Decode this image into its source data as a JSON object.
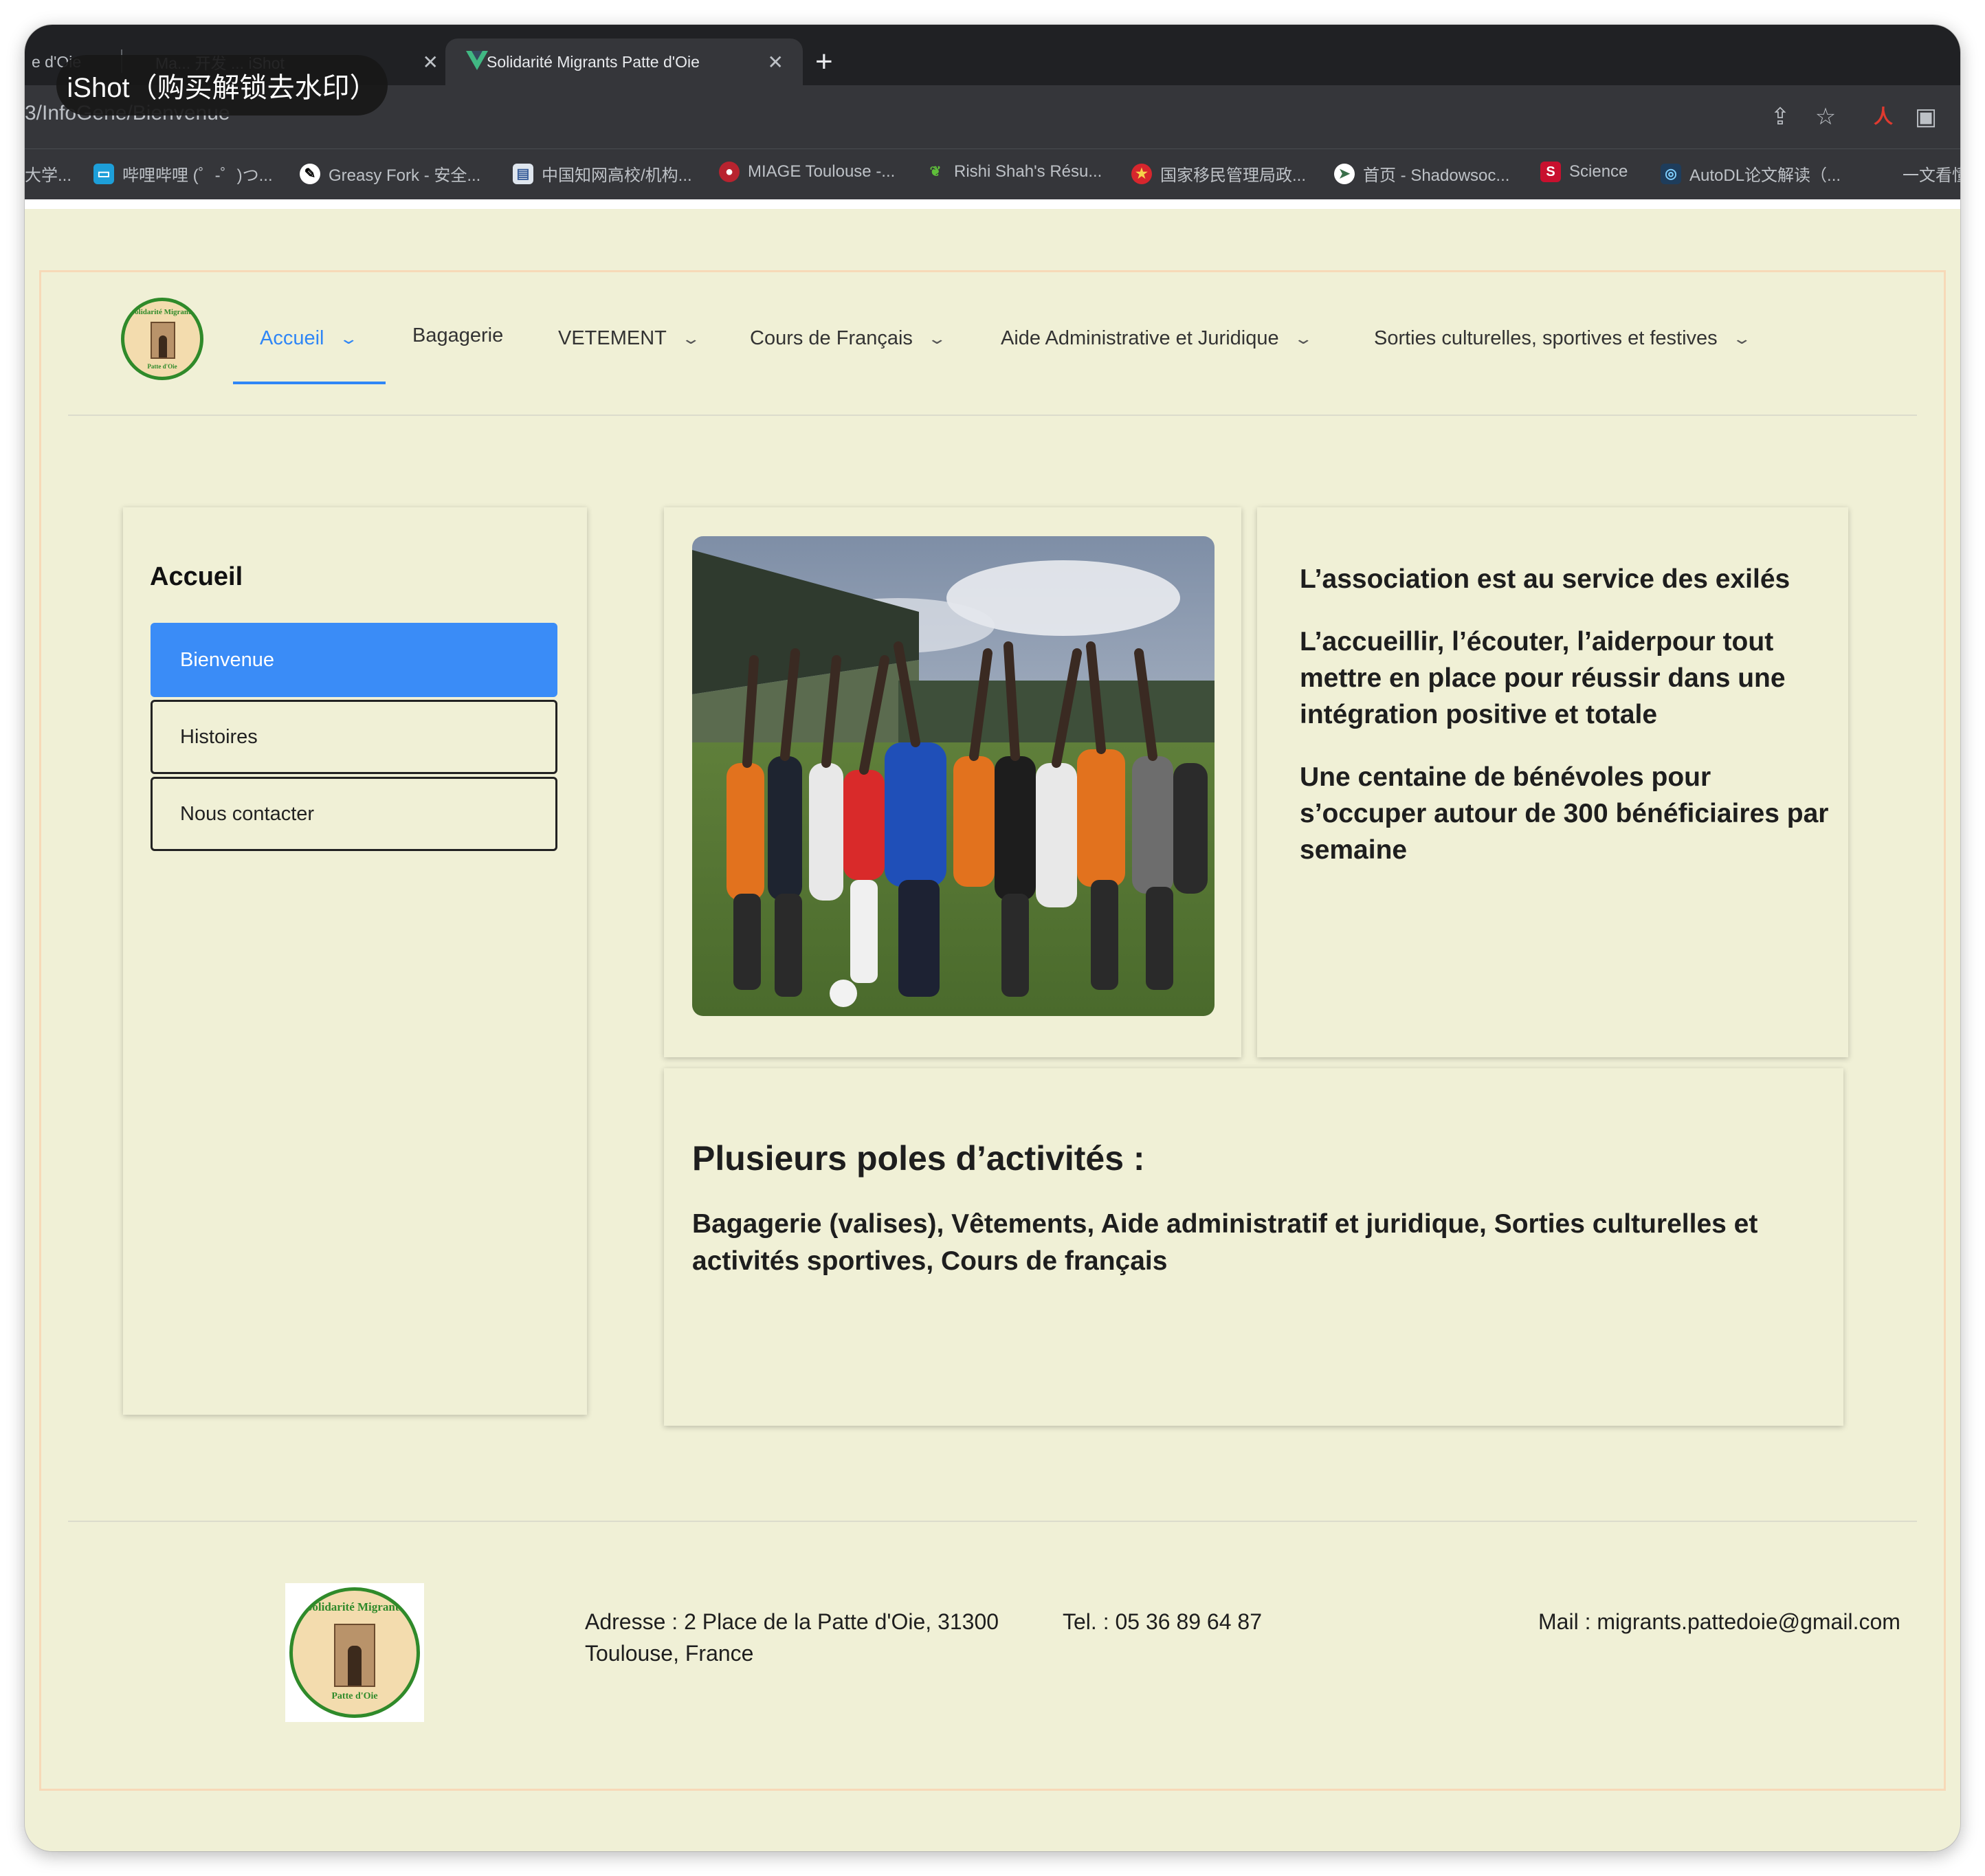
{
  "browser": {
    "tabs": [
      {
        "label": "e d'Oie",
        "active": false
      },
      {
        "label": "Ma... 开发 ... iShot",
        "active": false
      },
      {
        "label": "Solidarité Migrants Patte d'Oie",
        "active": true
      }
    ],
    "url": "3/InfoGene/Bienvenue",
    "watermark": "iShot（购买解锁去水印）",
    "bookmarks": [
      {
        "label": "大学...",
        "icon": "bookmark-icon"
      },
      {
        "label": "哔哩哔哩 (゜-゜)つ...",
        "icon": "bilibili-icon"
      },
      {
        "label": "Greasy Fork - 安全...",
        "icon": "greasyfork-icon"
      },
      {
        "label": "中国知网高校/机构...",
        "icon": "cnki-icon"
      },
      {
        "label": "MIAGE Toulouse -...",
        "icon": "miage-icon"
      },
      {
        "label": "Rishi Shah's Résu...",
        "icon": "leaf-icon"
      },
      {
        "label": "国家移民管理局政...",
        "icon": "emblem-icon"
      },
      {
        "label": "首页 - Shadowsoc...",
        "icon": "paper-plane-icon"
      },
      {
        "label": "Science",
        "icon": "science-icon"
      },
      {
        "label": "AutoDL论文解读（...",
        "icon": "autodl-icon"
      },
      {
        "label": "一文看懂",
        "icon": "none"
      }
    ]
  },
  "logo": {
    "top_text": "Solidarité Migrants",
    "bottom_text": "Patte d'Oie"
  },
  "nav": {
    "items": [
      {
        "label": "Accueil",
        "has_dropdown": true,
        "active": true
      },
      {
        "label": "Bagagerie",
        "has_dropdown": false,
        "active": false
      },
      {
        "label": "VETEMENT",
        "has_dropdown": true,
        "active": false
      },
      {
        "label": "Cours de Français",
        "has_dropdown": true,
        "active": false
      },
      {
        "label": "Aide Administrative et Juridique",
        "has_dropdown": true,
        "active": false
      },
      {
        "label": "Sorties culturelles, sportives et festives",
        "has_dropdown": true,
        "active": false
      }
    ]
  },
  "sidebar": {
    "title": "Accueil",
    "items": [
      {
        "label": "Bienvenue",
        "active": true
      },
      {
        "label": "Histoires",
        "active": false
      },
      {
        "label": "Nous contacter",
        "active": false
      }
    ]
  },
  "intro": {
    "p1": "L’association est au service des exilés",
    "p2": "L’accueillir, l’écouter, l’aiderpour tout mettre en place pour réussir dans une intégration positive et totale",
    "p3": "Une centaine de bénévoles pour s’occuper autour de 300 bénéficiaires par semaine"
  },
  "poles": {
    "title": "Plusieurs poles d’activités :",
    "text": "Bagagerie (valises), Vêtements, Aide administratif et juridique, Sorties culturelles et activités sportives, Cours de français"
  },
  "footer": {
    "address": "Adresse : 2 Place de la Patte d'Oie, 31300 Toulouse, France",
    "tel": "Tel. : 05 36 89 64 87",
    "mail": "Mail : migrants.pattedoie@gmail.com"
  },
  "colors": {
    "accent": "#2f86f6",
    "page_bg": "#f0f0d6",
    "logo_green": "#2f8a2a",
    "frame_border": "#f7d9b8"
  }
}
